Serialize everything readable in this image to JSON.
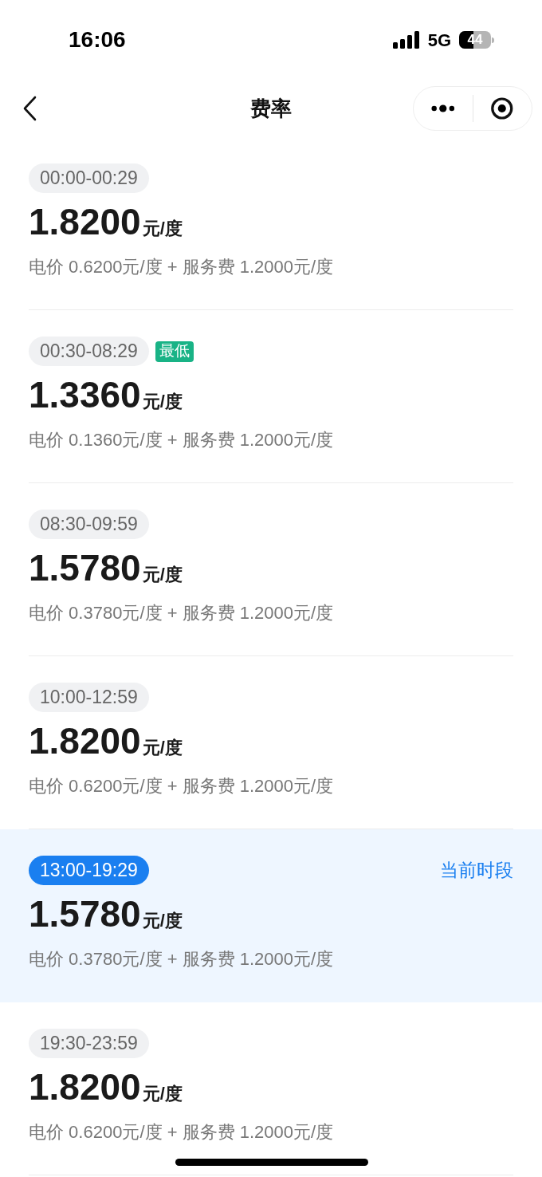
{
  "status_bar": {
    "time": "16:06",
    "network": "5G",
    "battery": "44"
  },
  "nav": {
    "title": "费率"
  },
  "rates": [
    {
      "time": "00:00-00:29",
      "selected": false,
      "price": "1.8200",
      "unit": "元/度",
      "detail": "电价 0.6200元/度 + 服务费 1.2000元/度"
    },
    {
      "time": "00:30-08:29",
      "selected": false,
      "badge": "最低",
      "price": "1.3360",
      "unit": "元/度",
      "detail": "电价 0.1360元/度 + 服务费 1.2000元/度"
    },
    {
      "time": "08:30-09:59",
      "selected": false,
      "price": "1.5780",
      "unit": "元/度",
      "detail": "电价 0.3780元/度 + 服务费 1.2000元/度"
    },
    {
      "time": "10:00-12:59",
      "selected": false,
      "price": "1.8200",
      "unit": "元/度",
      "detail": "电价 0.6200元/度 + 服务费 1.2000元/度"
    },
    {
      "time": "13:00-19:29",
      "selected": true,
      "note": "当前时段",
      "price": "1.5780",
      "unit": "元/度",
      "detail": "电价 0.3780元/度 + 服务费 1.2000元/度"
    },
    {
      "time": "19:30-23:59",
      "selected": false,
      "price": "1.8200",
      "unit": "元/度",
      "detail": "电价 0.6200元/度 + 服务费 1.2000元/度"
    }
  ]
}
